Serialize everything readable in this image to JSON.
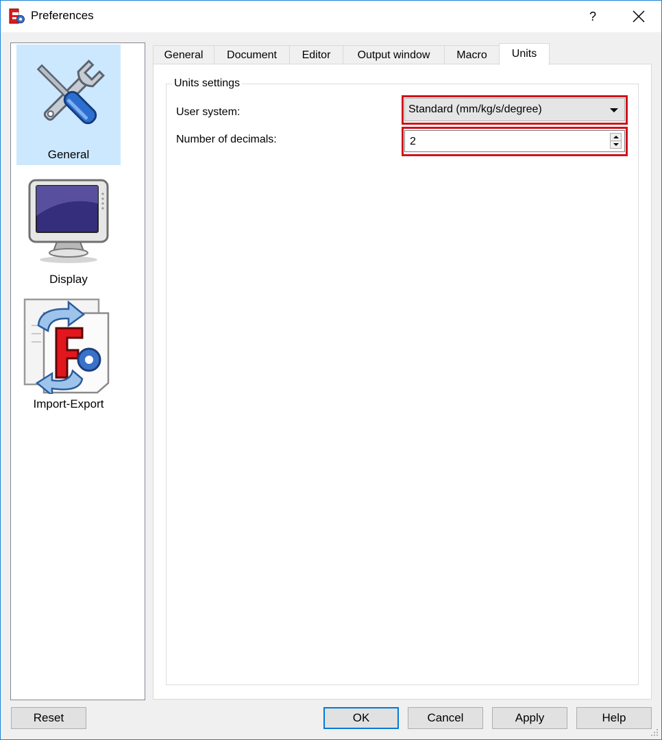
{
  "window": {
    "title": "Preferences",
    "help_label": "?",
    "close_icon": "close-icon"
  },
  "sidebar": {
    "items": [
      {
        "label": "General",
        "icon": "wrench-screwdriver-icon",
        "selected": true
      },
      {
        "label": "Display",
        "icon": "monitor-icon",
        "selected": false
      },
      {
        "label": "Import-Export",
        "icon": "import-export-icon",
        "selected": false
      }
    ]
  },
  "tabs": [
    {
      "label": "General",
      "active": false
    },
    {
      "label": "Document",
      "active": false
    },
    {
      "label": "Editor",
      "active": false
    },
    {
      "label": "Output window",
      "active": false
    },
    {
      "label": "Macro",
      "active": false
    },
    {
      "label": "Units",
      "active": true
    }
  ],
  "units_settings": {
    "group_title": "Units settings",
    "user_system_label": "User system:",
    "user_system_value": "Standard (mm/kg/s/degree)",
    "decimals_label": "Number of decimals:",
    "decimals_value": "2"
  },
  "buttons": {
    "reset": "Reset",
    "ok": "OK",
    "cancel": "Cancel",
    "apply": "Apply",
    "help": "Help"
  },
  "colors": {
    "highlight": "#d0121b",
    "selected_bg": "#cce8ff",
    "accent": "#0078d7"
  }
}
